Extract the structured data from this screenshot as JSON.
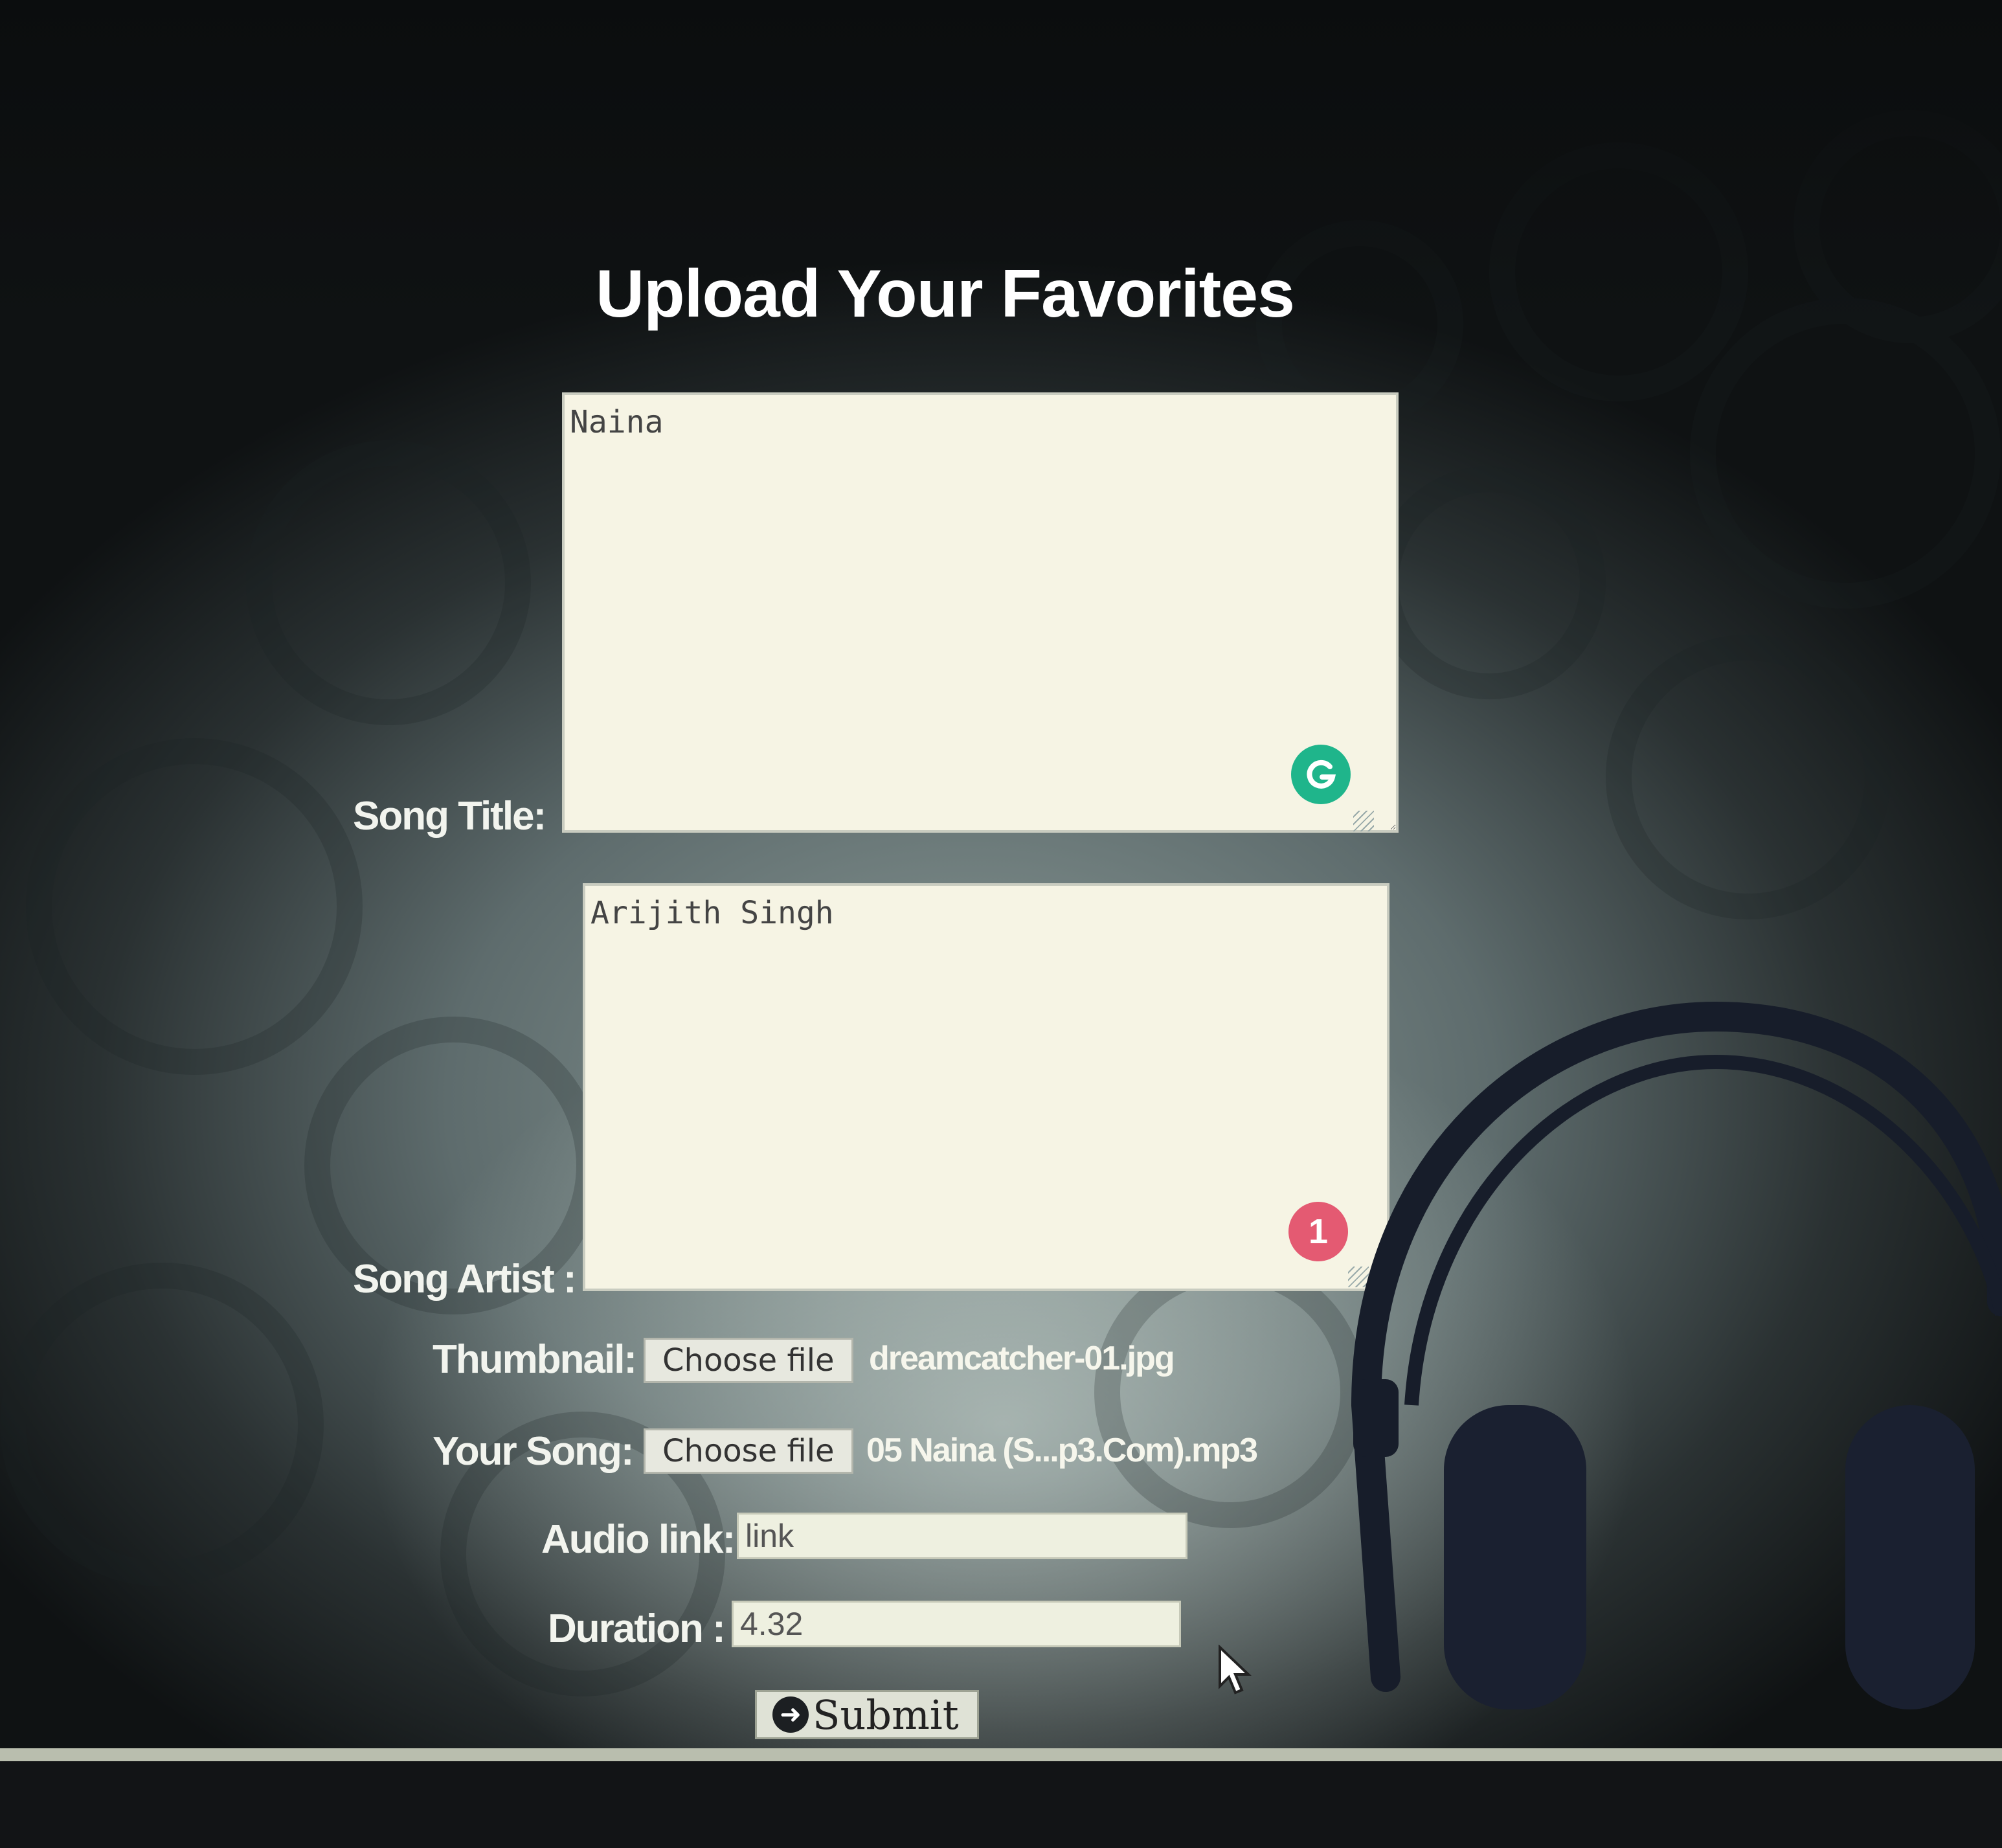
{
  "page": {
    "title": "Upload Your Favorites"
  },
  "form": {
    "song_title": {
      "label": "Song Title:",
      "value": "Naina",
      "badge_icon": "grammarly-icon"
    },
    "song_artist": {
      "label": "Song Artist :",
      "value": "Arijith Singh",
      "badge_count": "1"
    },
    "thumbnail": {
      "label": "Thumbnail:",
      "button_label": "Choose file",
      "file_name": "dreamcatcher-01.jpg"
    },
    "your_song": {
      "label": "Your Song:",
      "button_label": "Choose file",
      "file_name": "05 Naina (S...p3.Com).mp3"
    },
    "audio_link": {
      "label": "Audio link:",
      "value": "link"
    },
    "duration": {
      "label": "Duration :",
      "value": "4.32"
    },
    "submit_label": "Submit"
  },
  "colors": {
    "grammarly_badge": "#1fb58b",
    "issue_badge": "#e45a72",
    "textarea_bg": "#f6f4e4"
  }
}
